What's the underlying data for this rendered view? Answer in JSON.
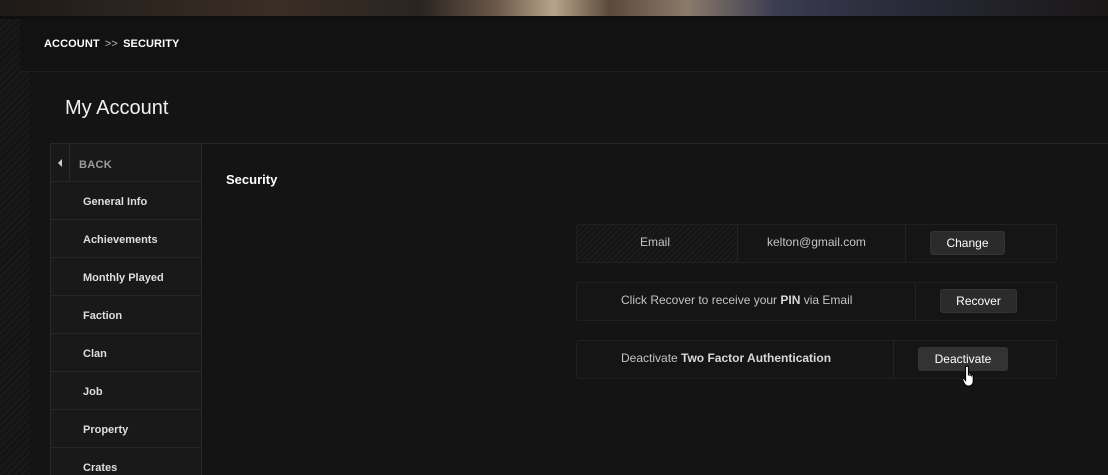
{
  "breadcrumb": {
    "root": "ACCOUNT",
    "separator": ">>",
    "current": "SECURITY"
  },
  "panel": {
    "title": "My Account"
  },
  "sidebar": {
    "back_label": "BACK",
    "items": [
      {
        "label": "General Info"
      },
      {
        "label": "Achievements"
      },
      {
        "label": "Monthly Played"
      },
      {
        "label": "Faction"
      },
      {
        "label": "Clan"
      },
      {
        "label": "Job"
      },
      {
        "label": "Property"
      },
      {
        "label": "Crates"
      }
    ]
  },
  "security": {
    "title": "Security",
    "email": {
      "label": "Email",
      "value": "kelton@gmail.com",
      "button": "Change"
    },
    "pin": {
      "text_before": "Click Recover to receive your ",
      "text_bold": "PIN",
      "text_after": " via Email",
      "button": "Recover"
    },
    "two_factor": {
      "text_before": "Deactivate ",
      "text_bold": "Two Factor Authentication",
      "button": "Deactivate"
    }
  }
}
